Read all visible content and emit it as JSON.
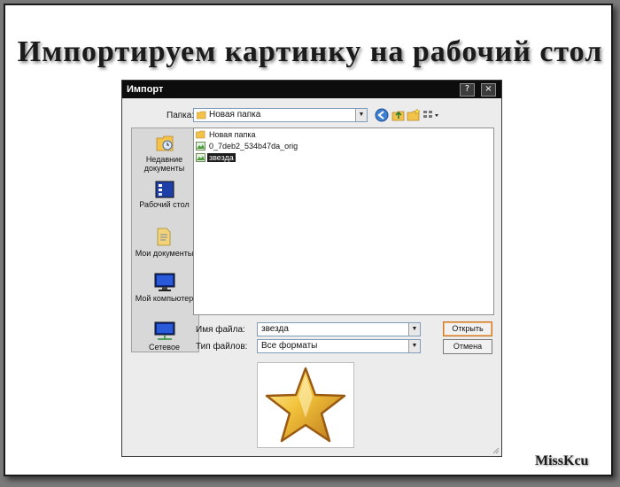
{
  "slide": {
    "title": "Импортируем картинку на рабочий стол",
    "watermark": "MissKcu"
  },
  "dialog": {
    "title": "Импорт",
    "titlebar_buttons": [
      "?",
      "×"
    ],
    "folder_label": "Папка:",
    "folder_value": "Новая папка",
    "toolbar_icons": [
      "back-icon",
      "up-folder-icon",
      "new-folder-icon",
      "view-menu-icon"
    ],
    "places": [
      {
        "label": "Недавние документы",
        "icon": "recent-documents-icon"
      },
      {
        "label": "Рабочий стол",
        "icon": "desktop-icon"
      },
      {
        "label": "Мои документы",
        "icon": "my-documents-icon"
      },
      {
        "label": "Мой компьютер",
        "icon": "my-computer-icon"
      },
      {
        "label": "Сетевое",
        "icon": "network-icon"
      }
    ],
    "files": [
      {
        "name": "Новая папка",
        "icon": "folder-icon",
        "selected": false
      },
      {
        "name": "0_7deb2_534b47da_orig",
        "icon": "image-file-icon",
        "selected": false
      },
      {
        "name": "звезда",
        "icon": "image-file-icon",
        "selected": true
      }
    ],
    "filename_label": "Имя файла:",
    "filename_value": "звезда",
    "filetype_label": "Тип файлов:",
    "filetype_value": "Все форматы",
    "open_button": "Открыть",
    "cancel_button": "Отмена",
    "preview_icon": "gold-star-icon"
  }
}
